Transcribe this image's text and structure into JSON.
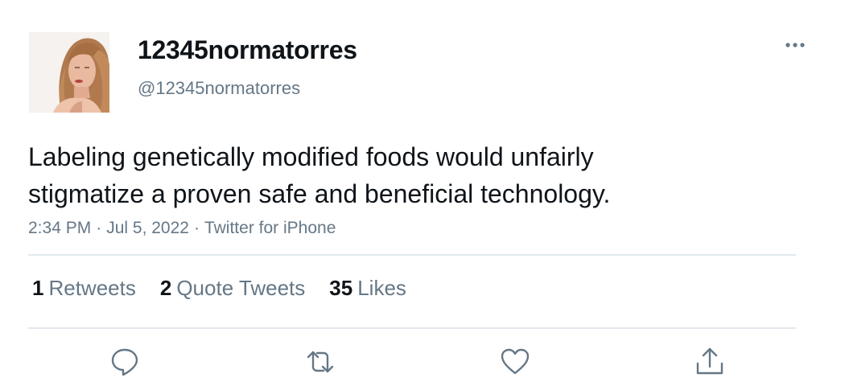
{
  "user": {
    "display_name": "12345normatorres",
    "handle": "@12345normatorres"
  },
  "tweet": {
    "text_lines": [
      "Labeling genetically modified foods would unfairly",
      "stigmatize a proven safe and beneficial technology."
    ],
    "time": "2:34 PM",
    "date": "Jul 5, 2022",
    "source": "Twitter for iPhone",
    "separator": "·"
  },
  "stats": {
    "retweets": {
      "count": "1",
      "label": "Retweets"
    },
    "quotes": {
      "count": "2",
      "label": "Quote Tweets"
    },
    "likes": {
      "count": "35",
      "label": "Likes"
    }
  },
  "icons": {
    "more": "more-horizontal-icon",
    "reply": "reply-icon",
    "retweet": "retweet-icon",
    "like": "heart-icon",
    "share": "share-icon"
  },
  "colors": {
    "text": "#0f1419",
    "secondary": "#657786",
    "divider": "#e1e8ed"
  }
}
